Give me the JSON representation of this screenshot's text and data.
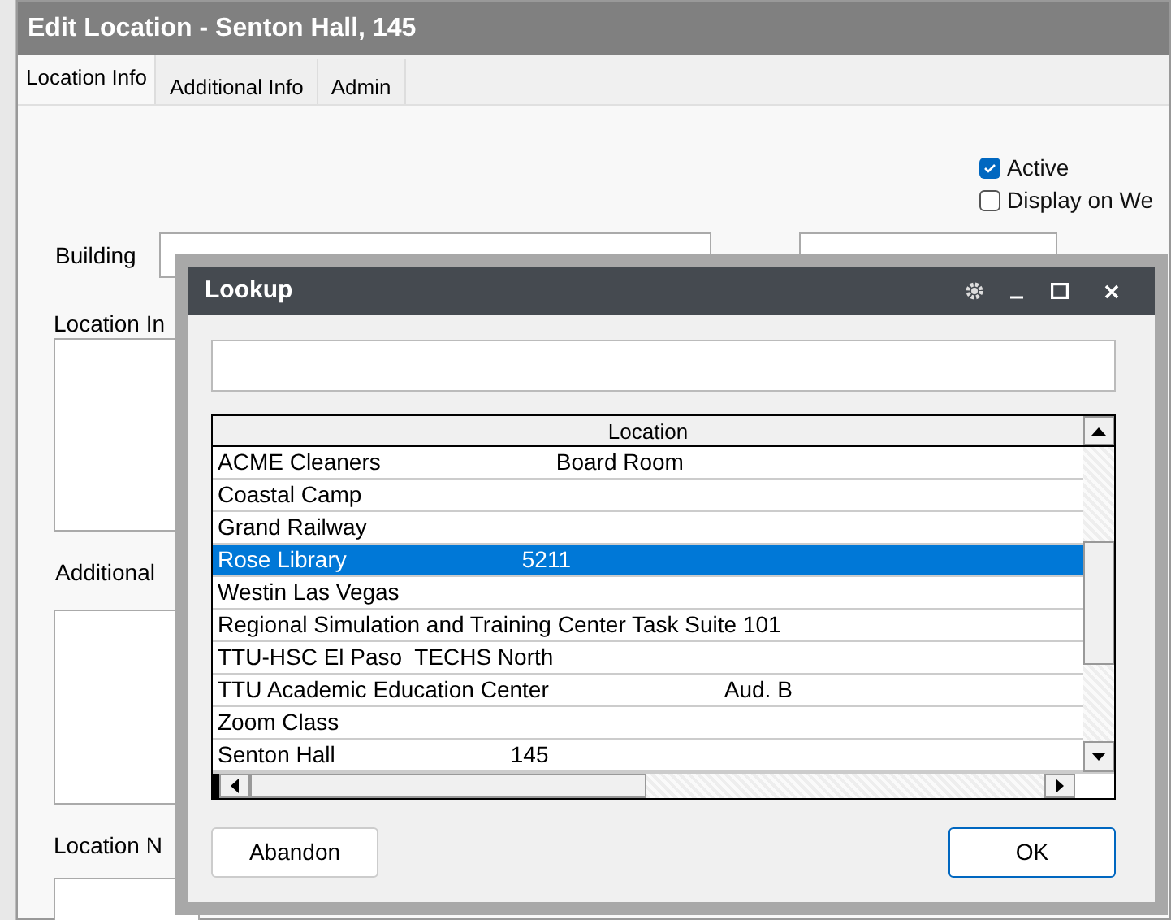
{
  "window": {
    "title": "Edit Location - Senton Hall, 145"
  },
  "tabs": [
    {
      "label": "Location Info",
      "selected": true
    },
    {
      "label": "Additional Info",
      "selected": false
    },
    {
      "label": "Admin",
      "selected": false
    }
  ],
  "options": [
    {
      "label": "Active",
      "checked": true
    },
    {
      "label": "Display on We",
      "checked": false
    }
  ],
  "form": {
    "building_label": "Building",
    "location_info_label": "Location In",
    "additional_label": "Additional",
    "location_notes_label": "Location N"
  },
  "dialog": {
    "title": "Lookup",
    "column": "Location",
    "rows": [
      {
        "name": "ACME Cleaners",
        "room": "Board Room",
        "selected": false
      },
      {
        "name": "Coastal Camp",
        "selected": false
      },
      {
        "name": "Grand Railway",
        "selected": false
      },
      {
        "name": "Rose Library",
        "room": "5211",
        "selected": true
      },
      {
        "name": "Westin Las Vegas",
        "selected": false
      },
      {
        "name": "Regional Simulation and Training Center Task Suite 101",
        "selected": false
      },
      {
        "name": "TTU-HSC El Paso  TECHS North",
        "selected": false
      },
      {
        "name": "TTU Academic Education Center",
        "room": "Aud. B",
        "selected": false
      },
      {
        "name": "Zoom Class",
        "selected": false
      },
      {
        "name": "Senton Hall",
        "room": "145",
        "selected": false
      }
    ],
    "buttons": [
      {
        "label": "Abandon",
        "kind": "plain"
      },
      {
        "label": "OK",
        "kind": "default"
      }
    ]
  }
}
